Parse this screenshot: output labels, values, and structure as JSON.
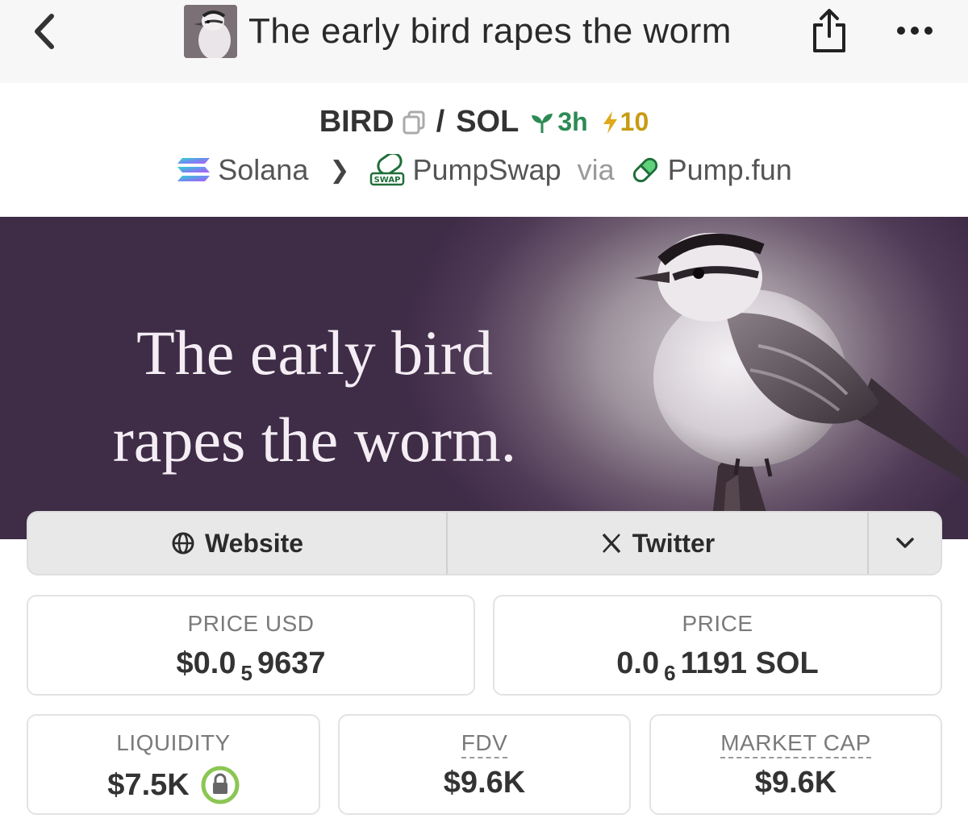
{
  "nav": {
    "back_icon": "chevron-left-icon",
    "title": "The early bird rapes the worm",
    "share_icon": "share-icon",
    "more_icon": "more-dots-icon"
  },
  "pair": {
    "base": "BIRD",
    "separator": "/",
    "quote": "SOL",
    "age": "3h",
    "boosts": "10",
    "age_color": "#2d8a55",
    "boost_color": "#c79b12"
  },
  "chain": {
    "network": "Solana",
    "dex": "PumpSwap",
    "via_label": "via",
    "launchpad": "Pump.fun",
    "dex_icon_text": "SWAP"
  },
  "banner": {
    "line1": "The early bird",
    "line2": "rapes the worm."
  },
  "links": {
    "website": "Website",
    "twitter": "Twitter"
  },
  "stats": {
    "price_usd_label": "PRICE USD",
    "price_usd_prefix": "$0.0",
    "price_usd_zeros": "5",
    "price_usd_digits": "9637",
    "price_label": "PRICE",
    "price_prefix": "0.0",
    "price_zeros": "6",
    "price_digits": "1191 SOL",
    "liquidity_label": "LIQUIDITY",
    "liquidity_value": "$7.5K",
    "fdv_label": "FDV",
    "fdv_value": "$9.6K",
    "mcap_label": "MARKET CAP",
    "mcap_value": "$9.6K"
  }
}
